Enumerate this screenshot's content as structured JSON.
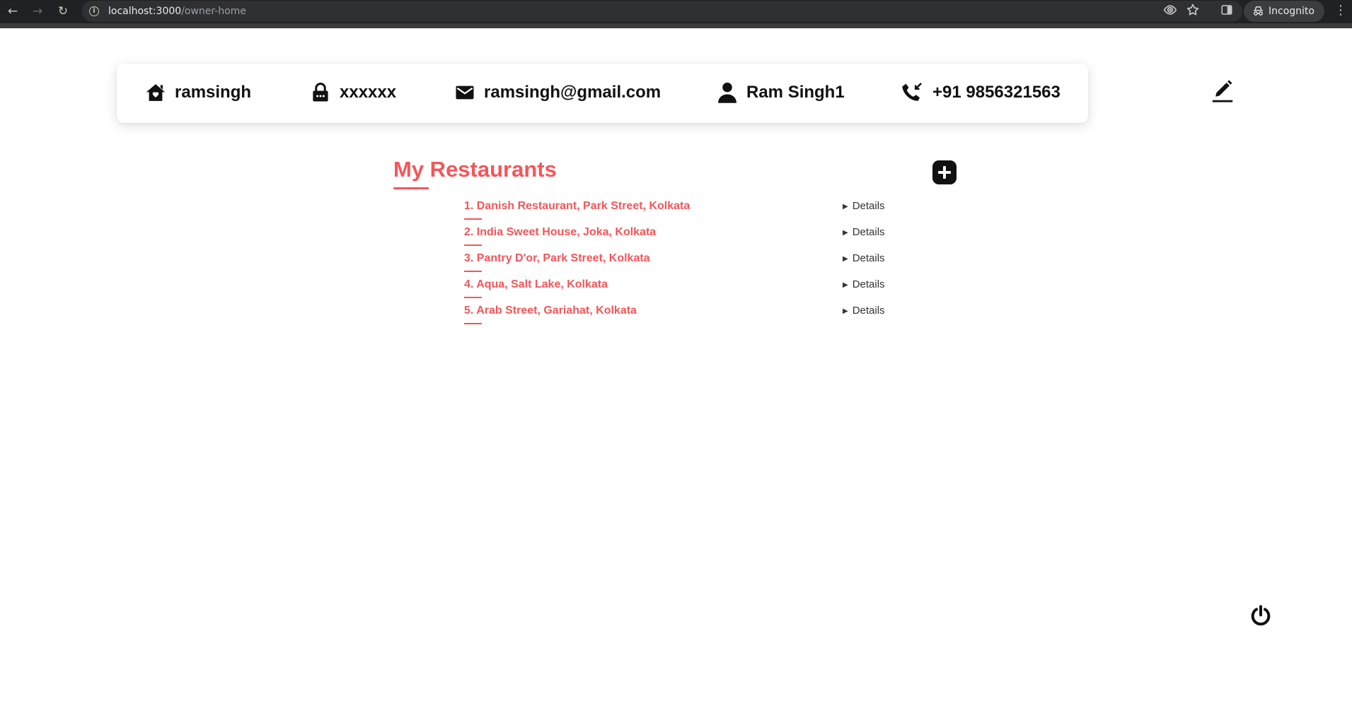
{
  "browser": {
    "back_icon": "arrow-left-icon",
    "forward_icon": "arrow-right-icon",
    "reload_icon": "reload-icon",
    "url_host": "localhost:3000",
    "url_path": "/owner-home",
    "incognito_label": "Incognito"
  },
  "profile": {
    "username": "ramsingh",
    "password": "xxxxxx",
    "email": "ramsingh@gmail.com",
    "name": "Ram Singh1",
    "phone": "+91 9856321563",
    "icons": [
      "home-icon",
      "lock-icon",
      "mail-icon",
      "person-icon",
      "phone-callback-icon",
      "edit-pencil-icon"
    ]
  },
  "restaurants_section": {
    "title": "My Restaurants",
    "items": [
      {
        "label": "1. Danish Restaurant, Park Street, Kolkata",
        "details": "Details"
      },
      {
        "label": "2. India Sweet House, Joka, Kolkata",
        "details": "Details"
      },
      {
        "label": "3. Pantry D'or, Park Street, Kolkata",
        "details": "Details"
      },
      {
        "label": "4. Aqua, Salt Lake, Kolkata",
        "details": "Details"
      },
      {
        "label": "5. Arab Street, Gariahat, Kolkata",
        "details": "Details"
      }
    ]
  },
  "colors": {
    "accent": "#f4565a",
    "text_dark": "#111111"
  }
}
